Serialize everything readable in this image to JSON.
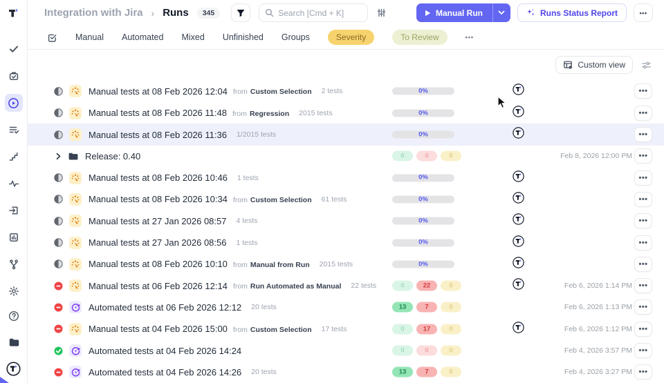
{
  "header": {
    "breadcrumb": {
      "project": "Integration with Jira",
      "separator": "›",
      "page": "Runs",
      "count": "345"
    },
    "search": {
      "placeholder": "Search [Cmd + K]"
    },
    "manual_run_label": "Manual Run",
    "runs_status_report_label": "Runs Status Report",
    "more_label": "•••"
  },
  "tabs": {
    "items": [
      "Manual",
      "Automated",
      "Mixed",
      "Unfinished",
      "Groups"
    ],
    "severity_label": "Severity",
    "to_review_label": "To Review",
    "more_label": "•••"
  },
  "viewbar": {
    "custom_view_label": "Custom view"
  },
  "labels": {
    "from": "from",
    "menu": "•••"
  },
  "colors": {
    "accent_indigo": "#6366f1",
    "severity_pill_bg": "#f7d36e",
    "to_review_pill_bg": "#edf0d2",
    "passed_green": "#22c55e",
    "failed_red": "#ef4444",
    "manual_icon_bg": "#fdf0c9",
    "automated_icon_bg": "#ede9fe",
    "row_highlight_bg": "#eef1fb"
  },
  "sidebar": {
    "icons": [
      "check",
      "briefcase-check",
      "play-circle-active",
      "list-check",
      "steps",
      "pulse",
      "box-arrow",
      "bar-chart",
      "branch",
      "gear",
      "help-circle",
      "folder",
      "user-avatar-t"
    ]
  },
  "rows": [
    {
      "status": "progress",
      "type": "manual",
      "title": "Manual tests at 08 Feb 2026 12:04",
      "from": "Custom Selection",
      "tests": "2 tests",
      "progress": "0%",
      "avatar": true
    },
    {
      "status": "progress",
      "type": "manual",
      "title": "Manual tests at 08 Feb 2026 11:48",
      "from": "Regression",
      "tests": "2015 tests",
      "progress": "0%",
      "avatar": true
    },
    {
      "status": "progress",
      "type": "manual",
      "title": "Manual tests at 08 Feb 2026 11:36",
      "tests": "1/2015 tests",
      "progress": "0%",
      "avatar": true,
      "highlighted": true
    },
    {
      "status": "none",
      "type": "group",
      "title": "Release: 0.40",
      "pills": {
        "passed": "0",
        "passed_active": false,
        "failed": "0",
        "failed_active": false,
        "skipped": "0",
        "skipped_active": false
      },
      "date": "Feb 8, 2026 12:00 PM"
    },
    {
      "status": "progress",
      "type": "manual",
      "title": "Manual tests at 08 Feb 2026 10:46",
      "tests": "1 tests",
      "progress": "0%",
      "avatar": true
    },
    {
      "status": "progress",
      "type": "manual",
      "title": "Manual tests at 08 Feb 2026 10:34",
      "from": "Custom Selection",
      "tests": "61 tests",
      "progress": "0%",
      "avatar": true
    },
    {
      "status": "progress",
      "type": "manual",
      "title": "Manual tests at 27 Jan 2026 08:57",
      "tests": "4 tests",
      "progress": "0%",
      "avatar": true
    },
    {
      "status": "progress",
      "type": "manual",
      "title": "Manual tests at 27 Jan 2026 08:56",
      "tests": "1 tests",
      "progress": "0%",
      "avatar": true
    },
    {
      "status": "progress",
      "type": "manual",
      "title": "Manual tests at 08 Feb 2026 10:10",
      "from": "Manual from Run",
      "tests": "2015 tests",
      "progress": "0%",
      "avatar": true
    },
    {
      "status": "failed",
      "type": "manual",
      "title": "Manual tests at 06 Feb 2026 12:14",
      "from": "Run Automated as Manual",
      "tests": "22 tests",
      "pills": {
        "passed": "0",
        "passed_active": false,
        "failed": "22",
        "failed_active": true,
        "skipped": "0",
        "skipped_active": false
      },
      "avatar": true,
      "date": "Feb 6, 2026 1:14 PM"
    },
    {
      "status": "failed",
      "type": "automated",
      "title": "Automated tests at 06 Feb 2026 12:12",
      "tests": "20 tests",
      "pills": {
        "passed": "13",
        "passed_active": true,
        "failed": "7",
        "failed_active": true,
        "skipped": "0",
        "skipped_active": false
      },
      "avatar": false,
      "date": "Feb 6, 2026 1:13 PM"
    },
    {
      "status": "failed",
      "type": "manual",
      "title": "Manual tests at 04 Feb 2026 15:00",
      "from": "Custom Selection",
      "tests": "17 tests",
      "pills": {
        "passed": "0",
        "passed_active": false,
        "failed": "17",
        "failed_active": true,
        "skipped": "0",
        "skipped_active": false
      },
      "avatar": true,
      "date": "Feb 6, 2026 1:12 PM"
    },
    {
      "status": "passed",
      "type": "automated",
      "title": "Automated tests at 04 Feb 2026 14:24",
      "pills": {
        "passed": "0",
        "passed_active": false,
        "failed": "0",
        "failed_active": false,
        "skipped": "0",
        "skipped_active": false
      },
      "avatar": false,
      "date": "Feb 4, 2026 3:57 PM"
    },
    {
      "status": "failed",
      "type": "automated",
      "title": "Automated tests at 04 Feb 2026 14:26",
      "tests": "20 tests",
      "pills": {
        "passed": "13",
        "passed_active": true,
        "failed": "7",
        "failed_active": true,
        "skipped": "0",
        "skipped_active": false
      },
      "avatar": false,
      "date": "Feb 4, 2026 3:27 PM"
    }
  ]
}
